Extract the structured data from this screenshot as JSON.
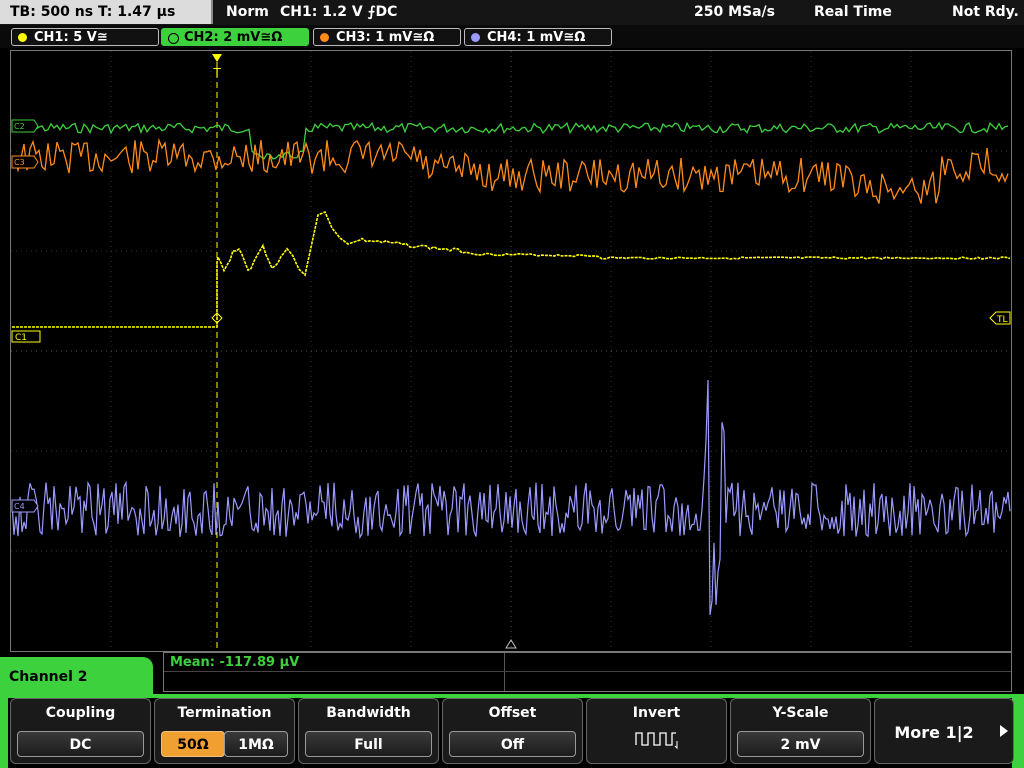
{
  "top": {
    "tb": "TB: 500 ns   T: 1.47 µs",
    "mode": "Norm",
    "trigger": "CH1: 1.2 V ⨍DC",
    "rate": "250 MSa/s",
    "acq": "Real Time",
    "status": "Not Rdy."
  },
  "channels": [
    {
      "label": "CH1: 5 V≅",
      "color": "#ffff00"
    },
    {
      "label": "CH2: 2 mV≅Ω",
      "color": "#3dd13d"
    },
    {
      "label": "CH3: 1 mV≅Ω",
      "color": "#ff8c1a"
    },
    {
      "label": "CH4: 1 mV≅Ω",
      "color": "#9a9aff"
    }
  ],
  "markers": {
    "c1": "C1",
    "tl": "TL",
    "ch2m": "C2",
    "ch3m": "C3",
    "ch4m": "C4"
  },
  "measure": {
    "mean": "Mean: -117.89 µV"
  },
  "menu": {
    "title": "Channel 2",
    "coupling": {
      "label": "Coupling",
      "value": "DC"
    },
    "termination": {
      "label": "Termination",
      "opt1": "50Ω",
      "opt2": "1MΩ"
    },
    "bandwidth": {
      "label": "Bandwidth",
      "value": "Full"
    },
    "offset": {
      "label": "Offset",
      "value": "Off"
    },
    "invert": {
      "label": "Invert",
      "icon": "square-wave-icon"
    },
    "yscale": {
      "label": "Y-Scale",
      "value": "2 mV"
    },
    "more": {
      "label": "More 1|2"
    }
  },
  "colors": {
    "ch1": "#ffff00",
    "ch2": "#3dd13d",
    "ch3": "#ff8c1a",
    "ch4": "#9a9aff",
    "accent": "#3dd13d"
  }
}
